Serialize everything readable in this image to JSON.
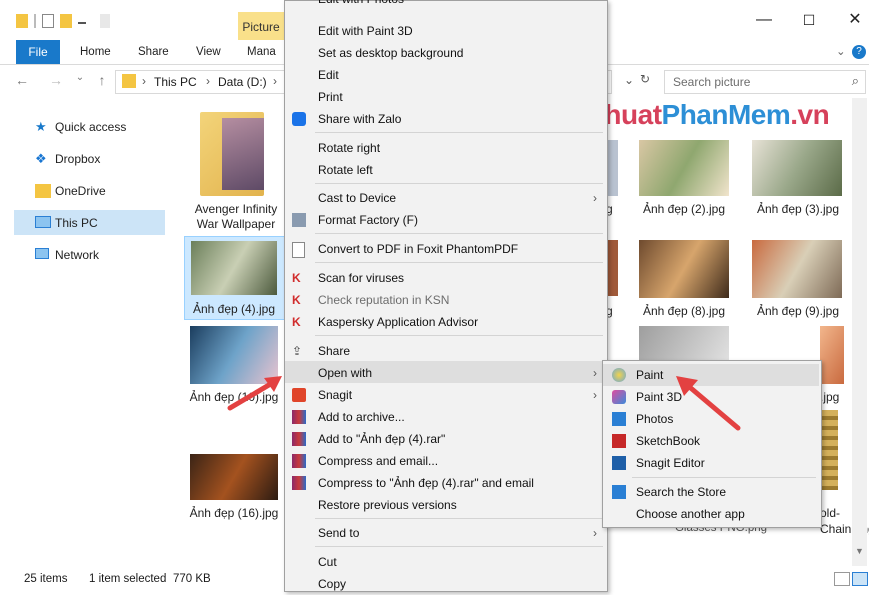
{
  "titlebar": {
    "picture_tools": "Picture",
    "minimize": "—",
    "maximize": "☐",
    "close": "✕"
  },
  "ribbon": {
    "file": "File",
    "home": "Home",
    "share": "Share",
    "view": "View",
    "manage": "Mana",
    "expand": "⌄",
    "help": "?"
  },
  "address": {
    "crumbs": [
      "This PC",
      "Data (D:)"
    ],
    "sep": "›",
    "search_placeholder": "Search picture"
  },
  "nav": {
    "items": [
      {
        "label": "Quick access"
      },
      {
        "label": "Dropbox"
      },
      {
        "label": "OneDrive"
      },
      {
        "label": "This PC"
      },
      {
        "label": "Network"
      }
    ]
  },
  "files": {
    "folder": {
      "line1": "Avenger Infinity",
      "line2": "War Wallpaper"
    },
    "items": [
      {
        "label": "Ảnh đẹp (4).jpg"
      },
      {
        "label": "Ảnh đẹp (10).jpg"
      },
      {
        "label": "Ảnh đẹp (16).jpg"
      },
      {
        "label": "g"
      },
      {
        "label": "Ảnh đẹp (2).jpg"
      },
      {
        "label": "Ảnh đẹp (3).jpg"
      },
      {
        "label": "g"
      },
      {
        "label": "Ảnh đẹp (8).jpg"
      },
      {
        "label": "Ảnh đẹp (9).jpg"
      },
      {
        "label": ".jpg"
      },
      {
        "label": "Glasses PNG.png"
      },
      {
        "label": "old-"
      },
      {
        "label": "Chain.png"
      }
    ]
  },
  "status": {
    "count": "25 items",
    "selected": "1 item selected",
    "size": "770 KB"
  },
  "context_menu": {
    "items": [
      {
        "label": "Edit with Photos"
      },
      {
        "label": "Edit with Paint 3D"
      },
      {
        "label": "Set as desktop background"
      },
      {
        "label": "Edit"
      },
      {
        "label": "Print"
      },
      {
        "label": "Share with Zalo"
      },
      {
        "label": "Rotate right"
      },
      {
        "label": "Rotate left"
      },
      {
        "label": "Cast to Device"
      },
      {
        "label": "Format Factory (F)"
      },
      {
        "label": "Convert to PDF in Foxit PhantomPDF"
      },
      {
        "label": "Scan for viruses"
      },
      {
        "label": "Check reputation in KSN"
      },
      {
        "label": "Kaspersky Application Advisor"
      },
      {
        "label": "Share"
      },
      {
        "label": "Open with"
      },
      {
        "label": "Snagit"
      },
      {
        "label": "Add to archive..."
      },
      {
        "label": "Add to \"Ảnh đẹp (4).rar\""
      },
      {
        "label": "Compress and email..."
      },
      {
        "label": "Compress to \"Ảnh đẹp (4).rar\" and email"
      },
      {
        "label": "Restore previous versions"
      },
      {
        "label": "Send to"
      },
      {
        "label": "Cut"
      },
      {
        "label": "Copy"
      }
    ]
  },
  "open_with": {
    "items": [
      {
        "label": "Paint"
      },
      {
        "label": "Paint 3D"
      },
      {
        "label": "Photos"
      },
      {
        "label": "SketchBook"
      },
      {
        "label": "Snagit Editor"
      },
      {
        "label": "Search the Store"
      },
      {
        "label": "Choose another app"
      }
    ]
  },
  "watermark": {
    "part1": "ThuThuat",
    "part2": "PhanMem",
    "part3": ".vn"
  },
  "colors": {
    "accent": "#1979ca",
    "selection": "#cce8ff",
    "arrow": "#e34141"
  }
}
